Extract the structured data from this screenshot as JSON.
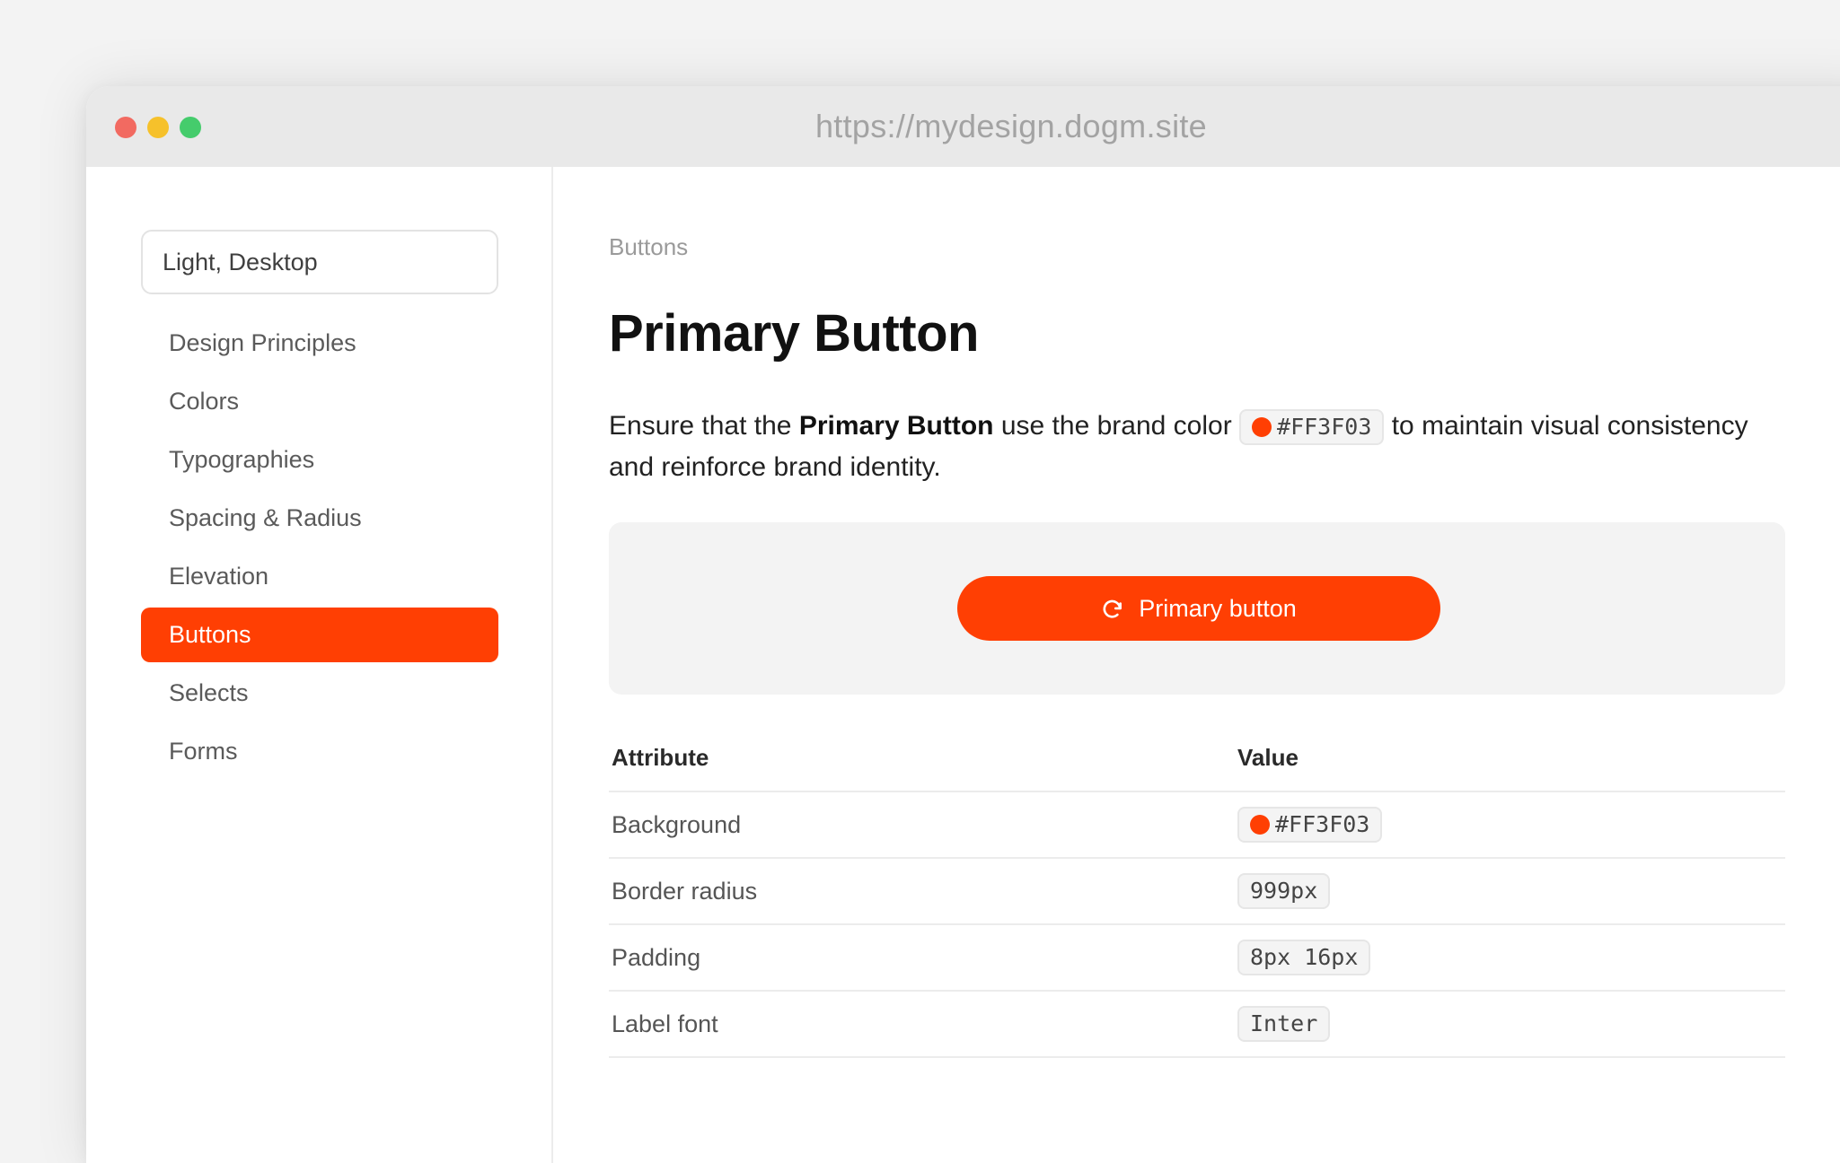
{
  "browser": {
    "url": "https://mydesign.dogm.site",
    "traffic_lights": {
      "close": "#f26a61",
      "minimize": "#f6c12b",
      "maximize": "#45cc6c"
    }
  },
  "sidebar": {
    "env_select": "Light, Desktop",
    "items": [
      {
        "label": "Design Principles",
        "active": false
      },
      {
        "label": "Colors",
        "active": false
      },
      {
        "label": "Typographies",
        "active": false
      },
      {
        "label": "Spacing & Radius",
        "active": false
      },
      {
        "label": "Elevation",
        "active": false
      },
      {
        "label": "Buttons",
        "active": true
      },
      {
        "label": "Selects",
        "active": false
      },
      {
        "label": "Forms",
        "active": false
      }
    ]
  },
  "main": {
    "breadcrumb": "Buttons",
    "title": "Primary Button",
    "description": {
      "prefix": "Ensure that the ",
      "bold": "Primary Button",
      "middle": " use the brand color ",
      "color_chip": "#FF3F03",
      "suffix": " to maintain visual consistency and reinforce brand identity."
    },
    "preview": {
      "button_label": "Primary button",
      "button_icon": "redo-arrow-icon"
    },
    "table": {
      "headers": {
        "attribute": "Attribute",
        "value": "Value"
      },
      "rows": [
        {
          "attribute": "Background",
          "value": "#FF3F03"
        },
        {
          "attribute": "Border radius",
          "value": "999px"
        },
        {
          "attribute": "Padding",
          "value": "8px 16px"
        },
        {
          "attribute": "Label font",
          "value": "Inter"
        }
      ]
    }
  },
  "colors": {
    "brand": "#FF3F03"
  }
}
